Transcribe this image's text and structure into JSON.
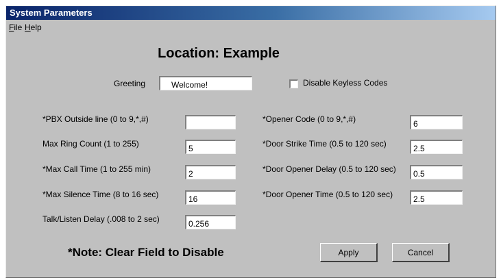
{
  "window": {
    "title": "System Parameters"
  },
  "menu": {
    "file": "File",
    "help": "Help"
  },
  "heading": "Location:  Example",
  "greeting": {
    "label": "Greeting",
    "value": "Welcome!"
  },
  "disable_keyless": {
    "label": "Disable Keyless Codes",
    "checked": false
  },
  "left_fields": [
    {
      "label": "*PBX Outside line (0 to 9,*,#)",
      "value": ""
    },
    {
      "label": "Max Ring Count (1 to 255)",
      "value": "5"
    },
    {
      "label": "*Max Call Time (1 to 255 min)",
      "value": "2"
    },
    {
      "label": "*Max Silence Time (8 to 16 sec)",
      "value": "16"
    },
    {
      "label": "Talk/Listen Delay (.008 to 2 sec)",
      "value": "0.256"
    }
  ],
  "right_fields": [
    {
      "label": "*Opener Code (0 to 9,*,#)",
      "value": "6"
    },
    {
      "label": "*Door Strike Time (0.5 to 120 sec)",
      "value": "2.5"
    },
    {
      "label": "*Door Opener Delay (0.5 to 120 sec)",
      "value": "0.5"
    },
    {
      "label": "*Door Opener Time (0.5 to 120 sec)",
      "value": "2.5"
    }
  ],
  "note": "*Note: Clear Field to Disable",
  "buttons": {
    "apply": "Apply",
    "cancel": "Cancel"
  }
}
